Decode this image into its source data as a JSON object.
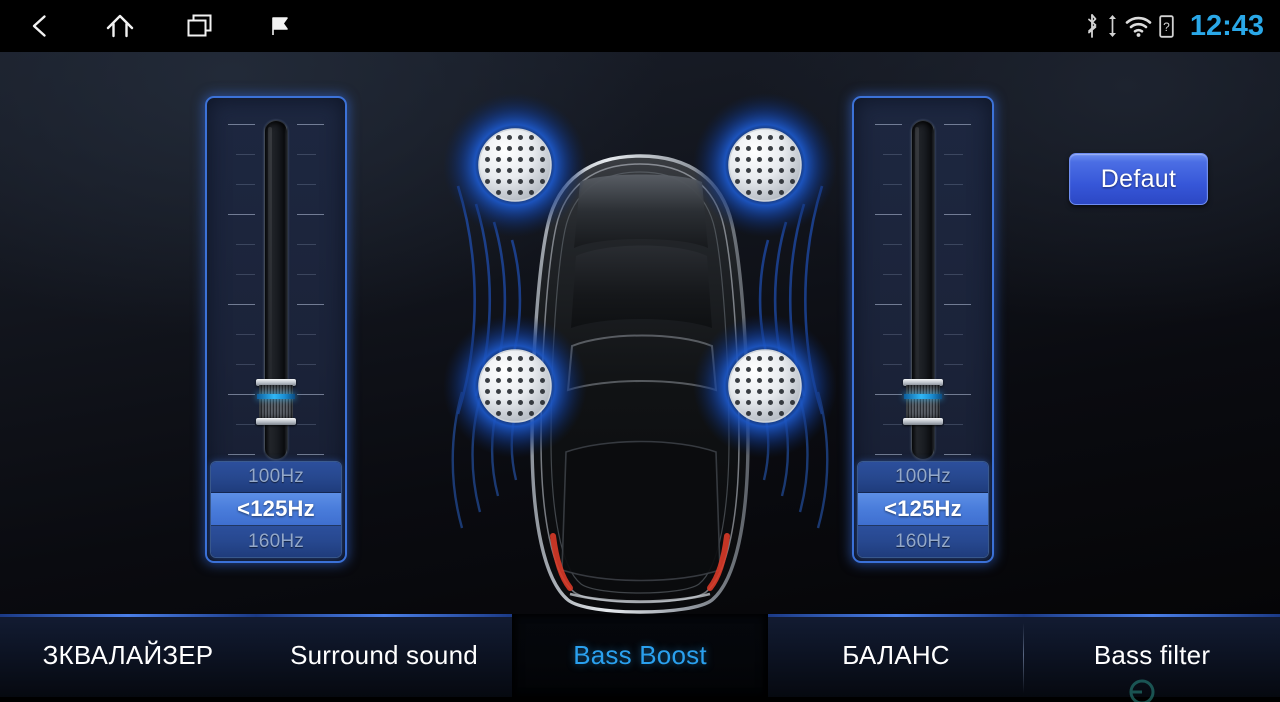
{
  "statusbar": {
    "nav": [
      {
        "name": "back-icon",
        "label": "Back"
      },
      {
        "name": "home-icon",
        "label": "Home"
      },
      {
        "name": "recents-icon",
        "label": "Recent apps"
      },
      {
        "name": "flag-icon",
        "label": "Flag"
      }
    ],
    "system_icons": [
      "bluetooth-icon",
      "usb-icon",
      "wifi-icon",
      "sim-unknown-icon"
    ],
    "clock": "12:43"
  },
  "header": {
    "title": "Bass Boost"
  },
  "main": {
    "default_button": {
      "label": "Defaut"
    },
    "sliders": [
      {
        "name": "bass-boost-front-slider",
        "value_percent": 12,
        "frequencies": [
          {
            "label": "100Hz",
            "selected": false
          },
          {
            "label": "<125Hz",
            "selected": true
          },
          {
            "label": "160Hz",
            "selected": false
          }
        ]
      },
      {
        "name": "bass-boost-rear-slider",
        "value_percent": 12,
        "frequencies": [
          {
            "label": "100Hz",
            "selected": false
          },
          {
            "label": "<125Hz",
            "selected": true
          },
          {
            "label": "160Hz",
            "selected": false
          }
        ]
      }
    ],
    "car_diagram": {
      "name": "car-top-view-diagram",
      "speakers": [
        {
          "name": "speaker-front-left",
          "position": "front-left"
        },
        {
          "name": "speaker-front-right",
          "position": "front-right"
        },
        {
          "name": "speaker-rear-left",
          "position": "rear-left"
        },
        {
          "name": "speaker-rear-right",
          "position": "rear-right"
        }
      ]
    }
  },
  "tabs": [
    {
      "label": "ЗКВАЛАЙЗЕР",
      "name": "tab-equalizer",
      "active": false
    },
    {
      "label": "Surround sound",
      "name": "tab-surround-sound",
      "active": false
    },
    {
      "label": "Bass Boost",
      "name": "tab-bass-boost",
      "active": true
    },
    {
      "label": "БАЛАНС",
      "name": "tab-balance",
      "active": false
    },
    {
      "label": "Bass filter",
      "name": "tab-bass-filter",
      "active": false
    }
  ],
  "colors": {
    "accent_blue": "#2aa0ee",
    "panel_border": "#3c72d8",
    "button_blue": "#4b6ee4",
    "selected_freq": "#5d8fe6",
    "speaker_halo": "#1f54b4",
    "taillight_red": "#d83a28"
  }
}
